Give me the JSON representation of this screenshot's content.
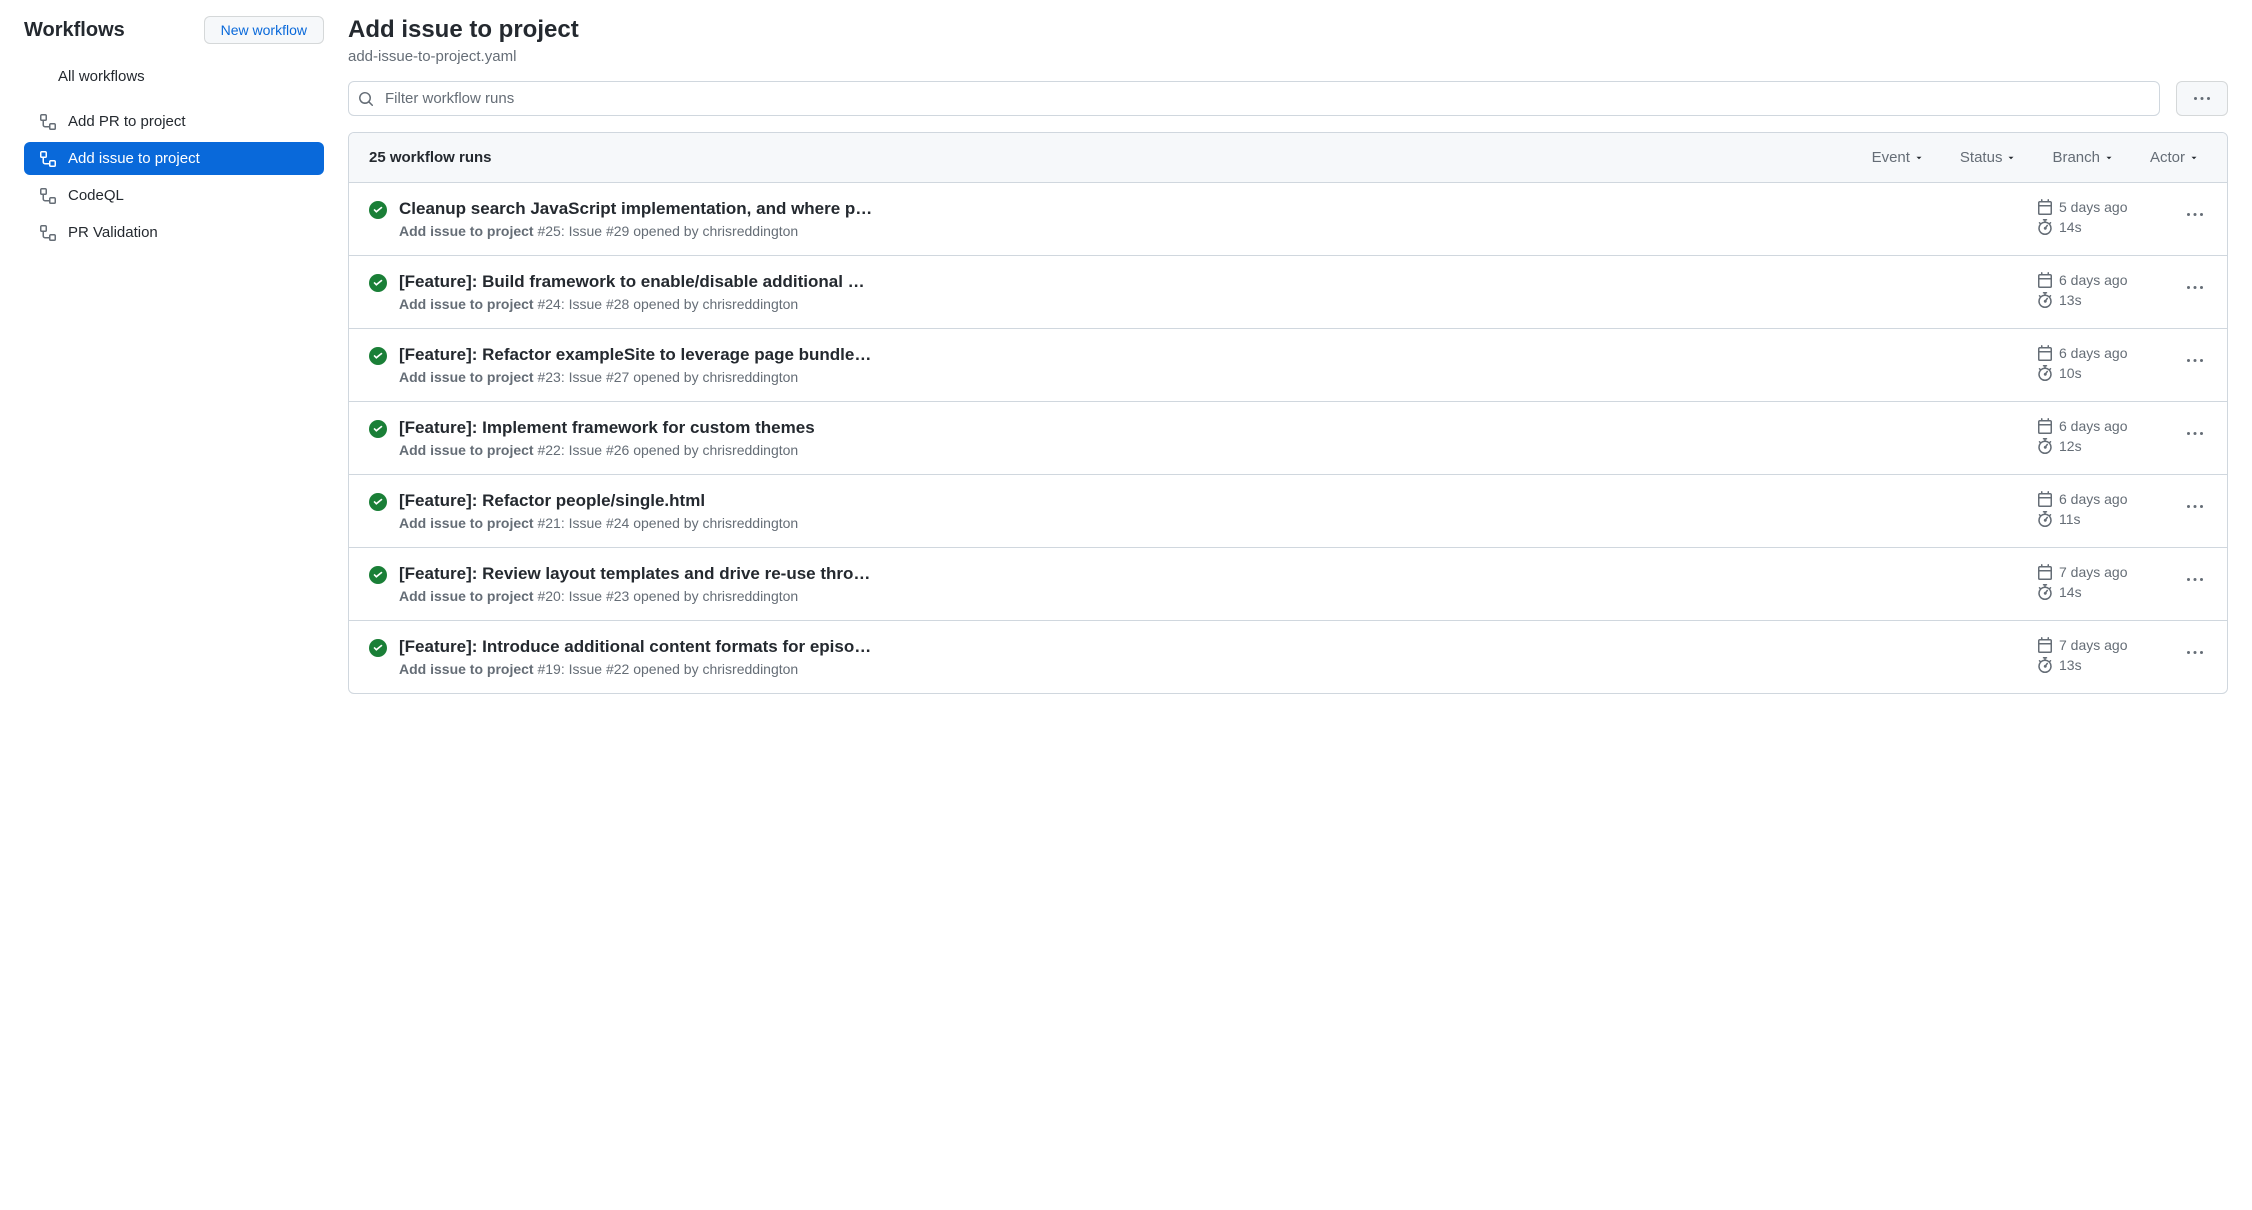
{
  "sidebar": {
    "title": "Workflows",
    "new_workflow_label": "New workflow",
    "all_label": "All workflows",
    "items": [
      {
        "label": "Add PR to project",
        "active": false
      },
      {
        "label": "Add issue to project",
        "active": true
      },
      {
        "label": "CodeQL",
        "active": false
      },
      {
        "label": "PR Validation",
        "active": false
      }
    ]
  },
  "main": {
    "title": "Add issue to project",
    "subtitle": "add-issue-to-project.yaml",
    "search_placeholder": "Filter workflow runs",
    "runs_count_label": "25 workflow runs",
    "filters": {
      "event": "Event",
      "status": "Status",
      "branch": "Branch",
      "actor": "Actor"
    },
    "runs": [
      {
        "title": "Cleanup search JavaScript implementation, and where p…",
        "workflow": "Add issue to project",
        "detail": "#25: Issue #29 opened by chrisreddington",
        "time": "5 days ago",
        "duration": "14s"
      },
      {
        "title": "[Feature]: Build framework to enable/disable additional …",
        "workflow": "Add issue to project",
        "detail": "#24: Issue #28 opened by chrisreddington",
        "time": "6 days ago",
        "duration": "13s"
      },
      {
        "title": "[Feature]: Refactor exampleSite to leverage page bundle…",
        "workflow": "Add issue to project",
        "detail": "#23: Issue #27 opened by chrisreddington",
        "time": "6 days ago",
        "duration": "10s"
      },
      {
        "title": "[Feature]: Implement framework for custom themes",
        "workflow": "Add issue to project",
        "detail": "#22: Issue #26 opened by chrisreddington",
        "time": "6 days ago",
        "duration": "12s"
      },
      {
        "title": "[Feature]: Refactor people/single.html",
        "workflow": "Add issue to project",
        "detail": "#21: Issue #24 opened by chrisreddington",
        "time": "6 days ago",
        "duration": "11s"
      },
      {
        "title": "[Feature]: Review layout templates and drive re-use thro…",
        "workflow": "Add issue to project",
        "detail": "#20: Issue #23 opened by chrisreddington",
        "time": "7 days ago",
        "duration": "14s"
      },
      {
        "title": "[Feature]: Introduce additional content formats for episo…",
        "workflow": "Add issue to project",
        "detail": "#19: Issue #22 opened by chrisreddington",
        "time": "7 days ago",
        "duration": "13s"
      }
    ]
  }
}
